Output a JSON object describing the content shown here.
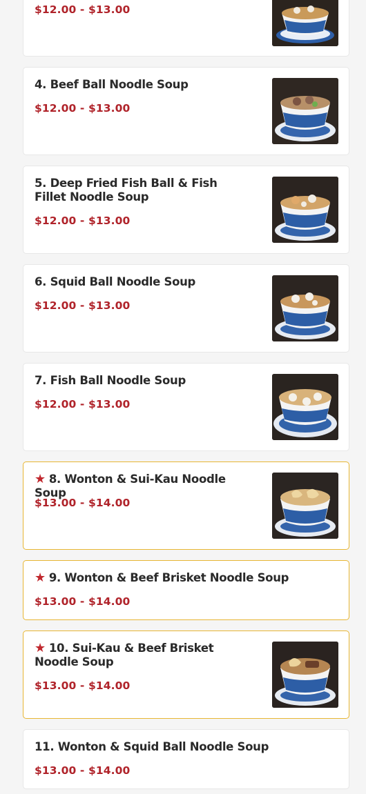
{
  "menu": {
    "items": [
      {
        "name": "",
        "price": "$12.00 - $13.00",
        "featured": false
      },
      {
        "name": "4. Beef Ball Noodle Soup",
        "price": "$12.00 - $13.00",
        "featured": false
      },
      {
        "name": "5. Deep Fried Fish Ball & Fish Fillet Noodle Soup",
        "price": "$12.00 - $13.00",
        "featured": false
      },
      {
        "name": "6. Squid Ball Noodle Soup",
        "price": "$12.00 - $13.00",
        "featured": false
      },
      {
        "name": "7. Fish Ball Noodle Soup",
        "price": "$12.00 - $13.00",
        "featured": false
      },
      {
        "name": "8. Wonton & Sui-Kau Noodle Soup",
        "price": "$13.00 - $14.00",
        "featured": true
      },
      {
        "name": "9. Wonton & Beef Brisket Noodle Soup",
        "price": "$13.00 - $14.00",
        "featured": true
      },
      {
        "name": "10. Sui-Kau & Beef Brisket Noodle Soup",
        "price": "$13.00 - $14.00",
        "featured": true
      },
      {
        "name": "11. Wonton & Squid Ball Noodle Soup",
        "price": "$13.00 - $14.00",
        "featured": false
      }
    ]
  },
  "colors": {
    "price": "#b0232a",
    "featured_border": "#e7b532",
    "star": "#c0272d"
  },
  "icons": {
    "featured": "star-icon"
  }
}
